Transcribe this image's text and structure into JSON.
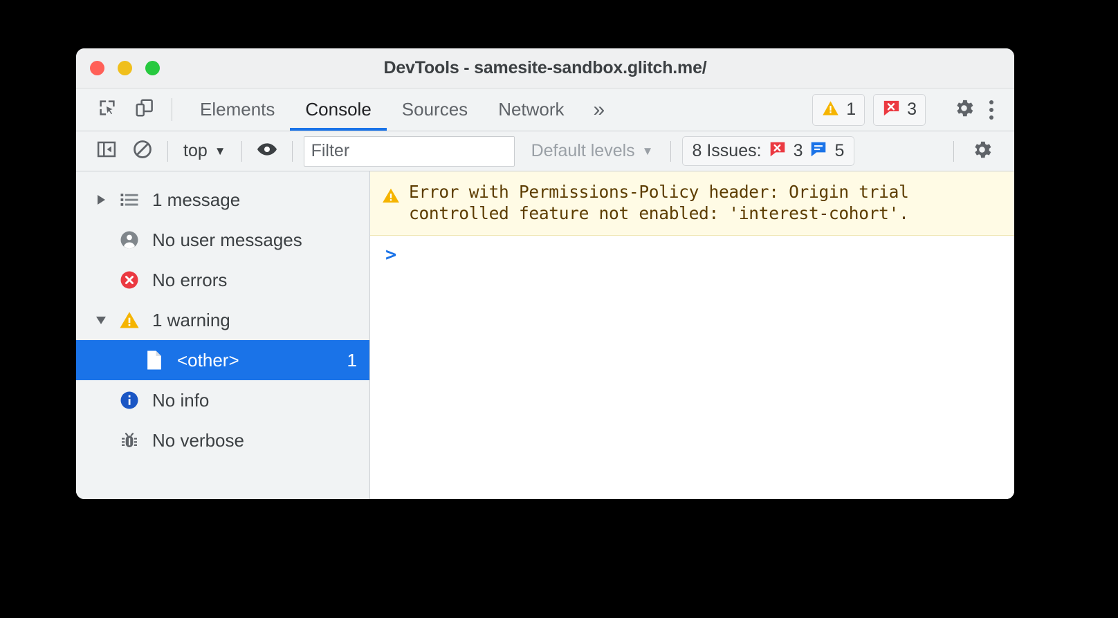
{
  "window": {
    "title": "DevTools - samesite-sandbox.glitch.me/",
    "traffic_lights": [
      {
        "name": "close",
        "color": "#ff6058"
      },
      {
        "name": "minimize",
        "color": "#f0bf1c"
      },
      {
        "name": "zoom",
        "color": "#27c93f"
      }
    ]
  },
  "tabbar": {
    "inspect_icon": "inspect-element-icon",
    "device_icon": "device-toolbar-icon",
    "tabs": [
      {
        "label": "Elements",
        "active": false
      },
      {
        "label": "Console",
        "active": true
      },
      {
        "label": "Sources",
        "active": false
      },
      {
        "label": "Network",
        "active": false
      }
    ],
    "more_tabs_label": "»",
    "warning_count": "1",
    "error_count": "3",
    "settings_icon": "gear-icon",
    "more_icon": "kebab-menu-icon"
  },
  "console_toolbar": {
    "sidebar_toggle_icon": "show-console-sidebar-icon",
    "clear_icon": "clear-console-icon",
    "context": "top",
    "context_caret": "▼",
    "live_expression_icon": "eye-icon",
    "filter_placeholder": "Filter",
    "filter_value": "",
    "levels_label": "Default levels",
    "levels_caret": "▼",
    "issues_label": "8 Issues:",
    "issues_error_count": "3",
    "issues_info_count": "5",
    "settings_icon": "gear-icon"
  },
  "sidebar": {
    "items": [
      {
        "label": "1 message",
        "icon": "list-icon",
        "twisty": "collapsed",
        "count": "",
        "selected": false,
        "indent": false
      },
      {
        "label": "No user messages",
        "icon": "user-icon",
        "twisty": "none",
        "count": "",
        "selected": false,
        "indent": false
      },
      {
        "label": "No errors",
        "icon": "error-icon",
        "twisty": "none",
        "count": "",
        "selected": false,
        "indent": false
      },
      {
        "label": "1 warning",
        "icon": "warning-icon",
        "twisty": "expanded",
        "count": "",
        "selected": false,
        "indent": false
      },
      {
        "label": "<other>",
        "icon": "file-icon",
        "twisty": "none",
        "count": "1",
        "selected": true,
        "indent": true
      },
      {
        "label": "No info",
        "icon": "info-icon",
        "twisty": "none",
        "count": "",
        "selected": false,
        "indent": false
      },
      {
        "label": "No verbose",
        "icon": "bug-icon",
        "twisty": "none",
        "count": "",
        "selected": false,
        "indent": false
      }
    ]
  },
  "console": {
    "messages": [
      {
        "level": "warning",
        "icon": "warning-icon",
        "text": "Error with Permissions-Policy header: Origin trial\ncontrolled feature not enabled: 'interest-cohort'."
      }
    ],
    "prompt_chevron": ">",
    "prompt_value": ""
  },
  "colors": {
    "accent": "#1a73e8",
    "warning": "#f5b400",
    "error": "#eb3941",
    "info": "#1a56c4",
    "warning_bg": "#fffbe5",
    "warning_text": "#5c3c00",
    "chrome_bg": "#f1f3f4"
  }
}
